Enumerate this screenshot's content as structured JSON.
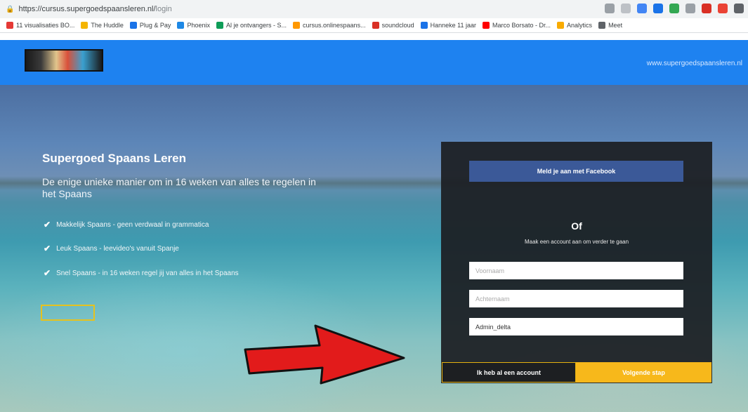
{
  "browser": {
    "url_main": "https://cursus.supergoedspaansleren.nl/",
    "url_path": "login",
    "bookmarks": [
      {
        "label": "11 visualisaties BO...",
        "color": "#e53935"
      },
      {
        "label": "The Huddle",
        "color": "#f4b400"
      },
      {
        "label": "Plug & Pay",
        "color": "#1a73e8"
      },
      {
        "label": "Phoenix",
        "color": "#1e88e5"
      },
      {
        "label": "Al je ontvangers - S...",
        "color": "#0f9d58"
      },
      {
        "label": "cursus.onlinespaans...",
        "color": "#ff9800"
      },
      {
        "label": "soundcloud",
        "color": "#d93025"
      },
      {
        "label": "Hanneke 11 jaar",
        "color": "#1a73e8"
      },
      {
        "label": "Marco Borsato - Dr...",
        "color": "#ff0000"
      },
      {
        "label": "Analytics",
        "color": "#f9ab00"
      },
      {
        "label": "Meet",
        "color": "#5f6368"
      }
    ]
  },
  "header": {
    "site_link": "www.supergoedspaansleren.nl"
  },
  "hero": {
    "title": "Supergoed Spaans Leren",
    "subtitle": "De enige unieke manier om in 16 weken van alles te regelen in het Spaans",
    "features": [
      "Makkelijk Spaans - geen verdwaal in grammatica",
      "Leuk Spaans - leevideo's vanuit Spanje",
      "Snel Spaans - in 16 weken regel jij van alles in het Spaans"
    ]
  },
  "signup": {
    "facebook_label": "Meld je aan met Facebook",
    "or_label": "Of",
    "make_account_text": "Maak een account aan om verder te gaan",
    "first_name_placeholder": "Voornaam",
    "last_name_placeholder": "Achternaam",
    "username_value": "Admin_delta",
    "have_account_label": "Ik heb al een account",
    "next_step_label": "Volgende stap"
  },
  "colors": {
    "header_blue": "#1e82f0",
    "facebook_blue": "#3b5998",
    "accent_yellow": "#f7b81b",
    "panel_dark": "#1c1e22",
    "arrow_red": "#e21b1b"
  }
}
